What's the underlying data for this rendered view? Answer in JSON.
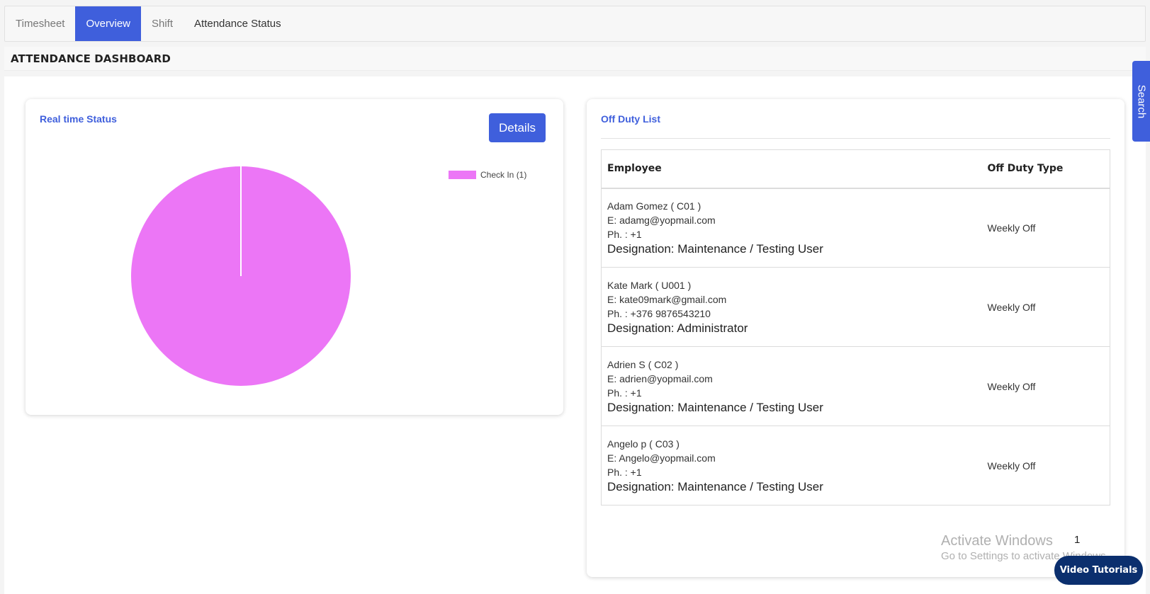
{
  "tabs": [
    {
      "label": "Timesheet"
    },
    {
      "label": "Overview"
    },
    {
      "label": "Shift"
    },
    {
      "label": "Attendance Status"
    }
  ],
  "page": {
    "title": "ATTENDANCE DASHBOARD"
  },
  "realtime": {
    "title": "Real time Status",
    "details_label": "Details"
  },
  "chart_data": {
    "type": "pie",
    "slices": [
      {
        "label": "Check In (1)",
        "value": 1,
        "color": "#ec76f6"
      }
    ],
    "legend": "top-right"
  },
  "offduty": {
    "title": "Off Duty List",
    "headers": {
      "employee": "Employee",
      "type": "Off Duty Type"
    },
    "rows": [
      {
        "name": "Adam Gomez ( C01 )",
        "email": "E: adamg@yopmail.com",
        "phone": "Ph. : +1",
        "designation": "Designation: Maintenance / Testing User",
        "type": "Weekly Off"
      },
      {
        "name": "Kate Mark ( U001 )",
        "email": "E: kate09mark@gmail.com",
        "phone": "Ph. : +376 9876543210",
        "designation": "Designation: Administrator",
        "type": "Weekly Off"
      },
      {
        "name": "Adrien S ( C02 )",
        "email": "E: adrien@yopmail.com",
        "phone": "Ph. : +1",
        "designation": "Designation: Maintenance / Testing User",
        "type": "Weekly Off"
      },
      {
        "name": "Angelo p ( C03 )",
        "email": "E: Angelo@yopmail.com",
        "phone": "Ph. : +1",
        "designation": "Designation: Maintenance / Testing User",
        "type": "Weekly Off"
      }
    ],
    "page_number": "1"
  },
  "watermark": {
    "line1": "Activate Windows",
    "line2": "Go to Settings to activate Windows."
  },
  "video_tutorials": "Video Tutorials",
  "search_label": "Search",
  "colors": {
    "accent": "#3f5fdc",
    "pie": "#ec76f6",
    "video_btn": "#0b2f6e"
  }
}
